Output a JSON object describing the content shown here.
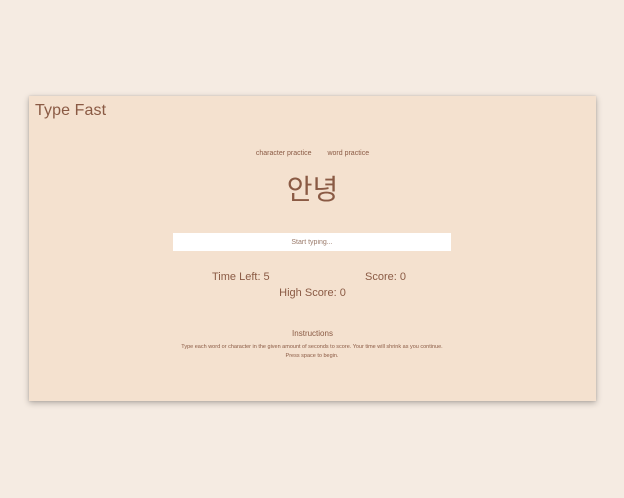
{
  "app": {
    "title": "Type Fast"
  },
  "modes": {
    "character_label": "character practice",
    "word_label": "word practice"
  },
  "prompt": {
    "text": "안녕"
  },
  "input": {
    "placeholder": "Start typing...",
    "value": ""
  },
  "stats": {
    "time_left": "Time Left: 5",
    "score": "Score: 0",
    "high_score": "High Score: 0"
  },
  "instructions": {
    "title": "Instructions",
    "text": "Type each word or character in the given amount of seconds to score. Your time will shrink as you continue. Press space to begin."
  },
  "colors": {
    "page_background": "#f5ebe2",
    "card_background": "#f4e1cf",
    "text": "#8a5a44",
    "input_background": "#ffffff"
  }
}
